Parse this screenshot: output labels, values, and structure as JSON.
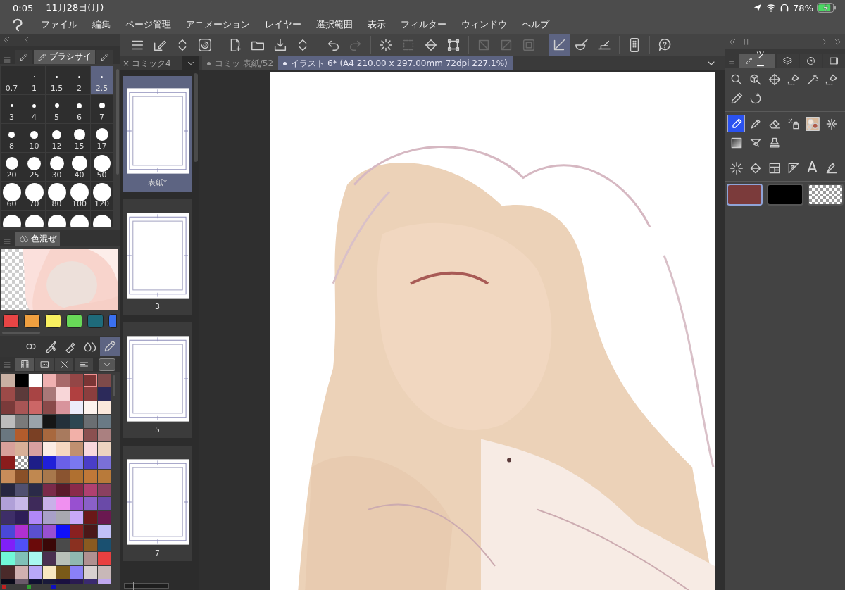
{
  "status_bar": {
    "time": "0:05",
    "date": "11月28日(月)",
    "battery": "78%"
  },
  "menu": {
    "items": [
      "ファイル",
      "編集",
      "ページ管理",
      "アニメーション",
      "レイヤー",
      "選択範囲",
      "表示",
      "フィルター",
      "ウィンドウ",
      "ヘルプ"
    ]
  },
  "toolbar": {
    "groups": [
      {
        "buttons": [
          {
            "selected": false,
            "disabled": false
          },
          {
            "selected": false,
            "disabled": false
          },
          {
            "selected": false,
            "disabled": false
          },
          {
            "selected": false,
            "disabled": false
          }
        ]
      },
      {
        "buttons": [
          {
            "selected": false,
            "disabled": false
          },
          {
            "selected": false,
            "disabled": false
          },
          {
            "selected": false,
            "disabled": false
          },
          {
            "selected": false,
            "disabled": false
          }
        ]
      },
      {
        "buttons": [
          {
            "selected": false,
            "disabled": false
          },
          {
            "selected": false,
            "disabled": true
          }
        ]
      },
      {
        "buttons": [
          {
            "selected": false,
            "disabled": false
          },
          {
            "selected": false,
            "disabled": true
          },
          {
            "selected": false,
            "disabled": false
          },
          {
            "selected": false,
            "disabled": false
          }
        ]
      },
      {
        "buttons": [
          {
            "selected": false,
            "disabled": true
          },
          {
            "selected": false,
            "disabled": true
          },
          {
            "selected": false,
            "disabled": true
          }
        ]
      },
      {
        "buttons": [
          {
            "selected": true,
            "disabled": false
          },
          {
            "selected": false,
            "disabled": false
          },
          {
            "selected": false,
            "disabled": false
          }
        ]
      },
      {
        "buttons": [
          {
            "selected": false,
            "disabled": false
          }
        ]
      },
      {
        "buttons": [
          {
            "selected": false,
            "disabled": false
          }
        ]
      }
    ]
  },
  "brush_size_panel": {
    "tabs": [
      {
        "selected": false
      },
      {
        "label": "ブラシサイ",
        "selected": true
      },
      {
        "selected": false
      }
    ],
    "sizes": [
      {
        "label": "0.7",
        "selected": false
      },
      {
        "label": "1",
        "selected": false
      },
      {
        "label": "1.5",
        "selected": false
      },
      {
        "label": "2",
        "selected": false
      },
      {
        "label": "2.5",
        "selected": true
      },
      {
        "label": "3",
        "selected": false
      },
      {
        "label": "4",
        "selected": false
      },
      {
        "label": "5",
        "selected": false
      },
      {
        "label": "6",
        "selected": false
      },
      {
        "label": "7",
        "selected": false
      },
      {
        "label": "8",
        "selected": false
      },
      {
        "label": "10",
        "selected": false
      },
      {
        "label": "12",
        "selected": false
      },
      {
        "label": "15",
        "selected": false
      },
      {
        "label": "17",
        "selected": false
      },
      {
        "label": "20",
        "selected": false
      },
      {
        "label": "25",
        "selected": false
      },
      {
        "label": "30",
        "selected": false
      },
      {
        "label": "40",
        "selected": false
      },
      {
        "label": "50",
        "selected": false
      },
      {
        "label": "60",
        "selected": false
      },
      {
        "label": "70",
        "selected": false
      },
      {
        "label": "80",
        "selected": false
      },
      {
        "label": "100",
        "selected": false
      },
      {
        "label": "120",
        "selected": false
      },
      {
        "selected": false
      },
      {
        "selected": false
      },
      {
        "selected": false
      },
      {
        "selected": false
      },
      {
        "selected": false
      }
    ]
  },
  "color_mix_panel": {
    "tab": "色混ぜ",
    "swatches": [
      {
        "color": "#e84545"
      },
      {
        "color": "#f0a040"
      },
      {
        "color": "#f8f060"
      },
      {
        "color": "#68d858"
      },
      {
        "color": "#1e6a7a"
      },
      {
        "color": "#3a70f0"
      }
    ],
    "tools": [
      {
        "selected": false
      },
      {
        "selected": false
      },
      {
        "selected": false
      },
      {
        "selected": false
      },
      {
        "selected": true
      }
    ]
  },
  "palette_panel": {
    "tabs": [
      {
        "selected": true
      },
      {
        "selected": false
      },
      {
        "selected": false
      },
      {
        "selected": false
      }
    ],
    "swatches": [
      {
        "kind": "color",
        "color": "#c9b0a3",
        "selected": false
      },
      {
        "kind": "color",
        "color": "#000000",
        "selected": false
      },
      {
        "kind": "color",
        "color": "#ffffff",
        "selected": false
      },
      {
        "kind": "color",
        "color": "#efb1b1",
        "selected": false
      },
      {
        "kind": "color",
        "color": "#a86a6a",
        "selected": false
      },
      {
        "kind": "color",
        "color": "#944646",
        "selected": false
      },
      {
        "kind": "color",
        "color": "#7b3535",
        "selected": true
      },
      {
        "kind": "color",
        "color": "#7d4a4a",
        "selected": false
      },
      {
        "kind": "color",
        "color": "#9c4a48",
        "selected": false
      },
      {
        "kind": "color",
        "color": "#5c3a3a",
        "selected": false
      },
      {
        "kind": "color",
        "color": "#a84444",
        "selected": false
      },
      {
        "kind": "color",
        "color": "#a87878",
        "selected": false
      },
      {
        "kind": "color",
        "color": "#f8d6d8",
        "selected": false
      },
      {
        "kind": "color",
        "color": "#b04040",
        "selected": false
      },
      {
        "kind": "color",
        "color": "#8b3e3e",
        "selected": false
      },
      {
        "kind": "color",
        "color": "#2c2a5a",
        "selected": false
      },
      {
        "kind": "color",
        "color": "#7a3a3a",
        "selected": false
      },
      {
        "kind": "color",
        "color": "#a85555",
        "selected": false
      },
      {
        "kind": "color",
        "color": "#cc6666",
        "selected": false
      },
      {
        "kind": "color",
        "color": "#8a4a4a",
        "selected": false
      },
      {
        "kind": "color",
        "color": "#d8949c",
        "selected": false
      },
      {
        "kind": "color",
        "color": "#ececfa",
        "selected": false
      },
      {
        "kind": "color",
        "color": "#fdf3ee",
        "selected": false
      },
      {
        "kind": "color",
        "color": "#fbe8dc",
        "selected": false
      },
      {
        "kind": "color",
        "color": "#bcbcbc",
        "selected": false
      },
      {
        "kind": "color",
        "color": "#7a7a7a",
        "selected": false
      },
      {
        "kind": "color",
        "color": "#9aa3aa",
        "selected": false
      },
      {
        "kind": "color",
        "color": "#161616",
        "selected": false
      },
      {
        "kind": "color",
        "color": "#24303a",
        "selected": false
      },
      {
        "kind": "color",
        "color": "#2d4752",
        "selected": false
      },
      {
        "kind": "color",
        "color": "#6a6e72",
        "selected": false
      },
      {
        "kind": "color",
        "color": "#6a7a85",
        "selected": false
      },
      {
        "kind": "color",
        "color": "#6a7780",
        "selected": false
      },
      {
        "kind": "color",
        "color": "#b25c2c",
        "selected": false
      },
      {
        "kind": "color",
        "color": "#7a4024",
        "selected": false
      },
      {
        "kind": "color",
        "color": "#a8683e",
        "selected": false
      },
      {
        "kind": "color",
        "color": "#a87a5e",
        "selected": false
      },
      {
        "kind": "color",
        "color": "#f2b0a8",
        "selected": false
      },
      {
        "kind": "color",
        "color": "#8a5050",
        "selected": false
      },
      {
        "kind": "color",
        "color": "#aa8080",
        "selected": false
      },
      {
        "kind": "color",
        "color": "#d8a09a",
        "selected": false
      },
      {
        "kind": "color",
        "color": "#d8b098",
        "selected": false
      },
      {
        "kind": "color",
        "color": "#d8a0a0",
        "selected": false
      },
      {
        "kind": "color",
        "color": "#fbece4",
        "selected": false
      },
      {
        "kind": "color",
        "color": "#f6d8c0",
        "selected": false
      },
      {
        "kind": "color",
        "color": "#c09070",
        "selected": false
      },
      {
        "kind": "color",
        "color": "#f8d8dc",
        "selected": false
      },
      {
        "kind": "color",
        "color": "#ecd4c0",
        "selected": false
      },
      {
        "kind": "color",
        "color": "#8a1c1c",
        "selected": false
      },
      {
        "kind": "transparent",
        "selected": false
      },
      {
        "kind": "color",
        "color": "#1e1e88",
        "selected": false
      },
      {
        "kind": "color",
        "color": "#2020d8",
        "selected": false
      },
      {
        "kind": "color",
        "color": "#6a60e8",
        "selected": false
      },
      {
        "kind": "color",
        "color": "#7a78f0",
        "selected": false
      },
      {
        "kind": "color",
        "color": "#4a3ec8",
        "selected": false
      },
      {
        "kind": "color",
        "color": "#7a70d8",
        "selected": false
      },
      {
        "kind": "color",
        "color": "#c88c5a",
        "selected": false
      },
      {
        "kind": "color",
        "color": "#8a5028",
        "selected": false
      },
      {
        "kind": "color",
        "color": "#c08850",
        "selected": false
      },
      {
        "kind": "color",
        "color": "#a8784c",
        "selected": false
      },
      {
        "kind": "color",
        "color": "#8a5430",
        "selected": false
      },
      {
        "kind": "color",
        "color": "#b07030",
        "selected": false
      },
      {
        "kind": "color",
        "color": "#c07838",
        "selected": false
      },
      {
        "kind": "color",
        "color": "#b87a3a",
        "selected": false
      },
      {
        "kind": "color",
        "color": "#262640",
        "selected": false
      },
      {
        "kind": "color",
        "color": "#505070",
        "selected": false
      },
      {
        "kind": "color",
        "color": "#2a2a48",
        "selected": false
      },
      {
        "kind": "color",
        "color": "#7a2a4a",
        "selected": false
      },
      {
        "kind": "color",
        "color": "#5a1a2a",
        "selected": false
      },
      {
        "kind": "color",
        "color": "#8a2a4a",
        "selected": false
      },
      {
        "kind": "color",
        "color": "#b04070",
        "selected": false
      },
      {
        "kind": "color",
        "color": "#8a4060",
        "selected": false
      },
      {
        "kind": "color",
        "color": "#b0a0d8",
        "selected": false
      },
      {
        "kind": "color",
        "color": "#c8b8e8",
        "selected": false
      },
      {
        "kind": "color",
        "color": "#3e2a5a",
        "selected": false
      },
      {
        "kind": "color",
        "color": "#c8b0e8",
        "selected": false
      },
      {
        "kind": "color",
        "color": "#f090f0",
        "selected": false
      },
      {
        "kind": "color",
        "color": "#9850d0",
        "selected": false
      },
      {
        "kind": "color",
        "color": "#8a60c8",
        "selected": false
      },
      {
        "kind": "color",
        "color": "#6a4aa8",
        "selected": false
      },
      {
        "kind": "color",
        "color": "#3e2e68",
        "selected": false
      },
      {
        "kind": "color",
        "color": "#2e1e58",
        "selected": false
      },
      {
        "kind": "color",
        "color": "#b088f8",
        "selected": false
      },
      {
        "kind": "color",
        "color": "#a8a0c8",
        "selected": false
      },
      {
        "kind": "color",
        "color": "#a8a8b0",
        "selected": false
      },
      {
        "kind": "color",
        "color": "#c8a8f8",
        "selected": false
      },
      {
        "kind": "color",
        "color": "#6a1818",
        "selected": false
      },
      {
        "kind": "color",
        "color": "#6a1850",
        "selected": false
      },
      {
        "kind": "color",
        "color": "#4a48d8",
        "selected": false
      },
      {
        "kind": "color",
        "color": "#b030d0",
        "selected": false
      },
      {
        "kind": "color",
        "color": "#5a50d0",
        "selected": false
      },
      {
        "kind": "color",
        "color": "#9850d1",
        "selected": false
      },
      {
        "kind": "color",
        "color": "#1010f8",
        "selected": false
      },
      {
        "kind": "color",
        "color": "#8a2020",
        "selected": false
      },
      {
        "kind": "color",
        "color": "#4a1818",
        "selected": false
      },
      {
        "kind": "color",
        "color": "#c0c0f8",
        "selected": false
      },
      {
        "kind": "color",
        "color": "#8020f8",
        "selected": false
      },
      {
        "kind": "color",
        "color": "#5050f8",
        "selected": false
      },
      {
        "kind": "color",
        "color": "#6a0a0a",
        "selected": false
      },
      {
        "kind": "color",
        "color": "#3a0808",
        "selected": false
      },
      {
        "kind": "color",
        "color": "#4a4a4a",
        "selected": false
      },
      {
        "kind": "color",
        "color": "#8a3020",
        "selected": false
      },
      {
        "kind": "color",
        "color": "#8a5a20",
        "selected": false
      },
      {
        "kind": "color",
        "color": "#1a5070",
        "selected": false
      },
      {
        "kind": "color",
        "color": "#70f8d8",
        "selected": false
      },
      {
        "kind": "color",
        "color": "#80c0b8",
        "selected": false
      },
      {
        "kind": "color",
        "color": "#a8f8f0",
        "selected": false
      },
      {
        "kind": "color",
        "color": "#4a3050",
        "selected": false
      },
      {
        "kind": "color",
        "color": "#b8c0b8",
        "selected": false
      },
      {
        "kind": "color",
        "color": "#90b8b0",
        "selected": false
      },
      {
        "kind": "color",
        "color": "#b09090",
        "selected": false
      },
      {
        "kind": "color",
        "color": "#e84040",
        "selected": false
      },
      {
        "kind": "color",
        "color": "#4a2a2a",
        "selected": false
      },
      {
        "kind": "color",
        "color": "#d0b0b0",
        "selected": false
      },
      {
        "kind": "color",
        "color": "#b8a8f8",
        "selected": false
      },
      {
        "kind": "color",
        "color": "#f8e8c0",
        "selected": false
      },
      {
        "kind": "color",
        "color": "#7a5a18",
        "selected": false
      },
      {
        "kind": "color",
        "color": "#8a80f8",
        "selected": false
      },
      {
        "kind": "color",
        "color": "#d8d0d0",
        "selected": false
      },
      {
        "kind": "color",
        "color": "#c8b8b8",
        "selected": false
      },
      {
        "kind": "color",
        "color": "#0a0a1a",
        "selected": false
      },
      {
        "kind": "color",
        "color": "#6a5a6a",
        "selected": false
      },
      {
        "kind": "color",
        "color": "#101030",
        "selected": false
      },
      {
        "kind": "color",
        "color": "#1a1a3a",
        "selected": false
      },
      {
        "kind": "color",
        "color": "#1a1040",
        "selected": false
      },
      {
        "kind": "color",
        "color": "#2a1a50",
        "selected": false
      },
      {
        "kind": "color",
        "color": "#3a2a70",
        "selected": false
      },
      {
        "kind": "color",
        "color": "#c0a8f0",
        "selected": false
      }
    ],
    "indicators": [
      {
        "color": "#c02020"
      },
      {
        "color": "#30a030"
      },
      {
        "color": "#1010c0"
      }
    ]
  },
  "pages_panel": {
    "close": "×",
    "title": "コミック4",
    "zoom": {
      "level": 0.2
    },
    "pages": [
      {
        "label": "表紙*",
        "selected": true
      },
      {
        "label": "3",
        "selected": false
      },
      {
        "label": "5",
        "selected": false
      },
      {
        "label": "7",
        "selected": false
      }
    ]
  },
  "canvas": {
    "tabs": [
      {
        "label": "コミッ 表紙/52",
        "selected": false
      },
      {
        "label": "イラスト 6* (A4 210.00 x 297.00mm 72dpi 227.1%)",
        "selected": true
      }
    ]
  },
  "tool_panel": {
    "tabs": [
      {
        "label": "ツー",
        "selected": true
      },
      {
        "selected": false
      },
      {
        "selected": false
      },
      {
        "selected": false
      }
    ],
    "groups": [
      {
        "tools": [
          {
            "selected": false
          },
          {
            "selected": false
          },
          {
            "selected": false
          },
          {
            "selected": false
          },
          {
            "selected": false
          },
          {
            "selected": false
          },
          {
            "selected": false
          },
          {
            "selected": false
          }
        ]
      },
      {
        "tools": [
          {
            "selected": true
          },
          {
            "selected": false
          },
          {
            "selected": false
          },
          {
            "selected": false
          },
          {
            "selected": false
          },
          {
            "selected": false
          },
          {
            "selected": false
          },
          {
            "selected": false
          },
          {
            "selected": false
          }
        ]
      },
      {
        "tools": [
          {
            "selected": false
          },
          {
            "selected": false
          },
          {
            "selected": false
          },
          {
            "selected": false
          },
          {
            "glyph": "A",
            "selected": false
          },
          {
            "selected": false
          }
        ]
      }
    ],
    "colors": [
      {
        "kind": "color",
        "color": "#7b3b3b",
        "selected": true
      },
      {
        "kind": "color",
        "color": "#000000",
        "selected": false
      },
      {
        "kind": "transparent",
        "selected": false
      }
    ]
  }
}
